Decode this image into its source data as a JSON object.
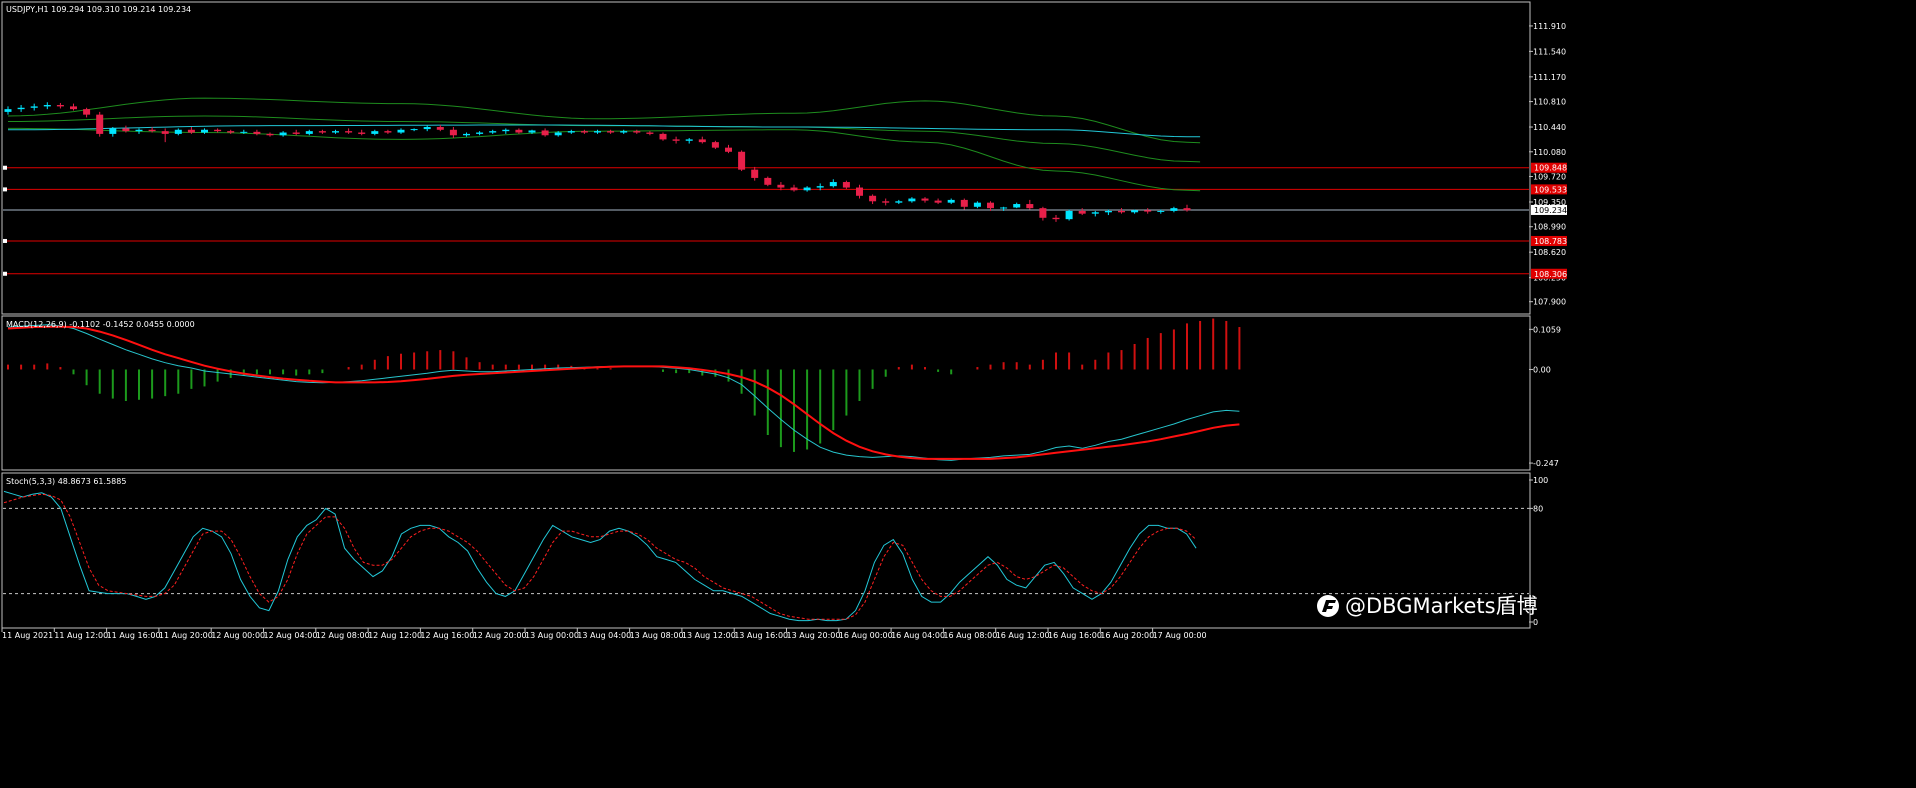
{
  "colors": {
    "background": "#000000",
    "frame": "#c0c0c0",
    "text": "#ffffff",
    "bull_candle": "#00e5ff",
    "bear_candle": "#e8204a",
    "bands": "#1e8c1e",
    "ma_slow": "#22c8d8",
    "red_level": "#e00000",
    "price_line": "#a9b8c8",
    "macd_line": "#27c4cc",
    "signal_line": "#ff1010",
    "hist_up": "#d01010",
    "hist_down": "#1c9a1c",
    "stoch_main": "#22c8d8",
    "stoch_signal": "#ff2020",
    "stoch_levels": "#c8c8c8"
  },
  "header": {
    "symbol_info": "USDJPY,H1  109.294 109.310 109.214 109.234"
  },
  "watermark": {
    "text": "@DBGMarkets盾博",
    "logo_icon": "dbg-logo-icon"
  },
  "chart_data": [
    {
      "type": "candlestick",
      "title": "USDJPY,H1",
      "ohlc_last": [
        109.294,
        109.31,
        109.214,
        109.234
      ],
      "ylim": [
        107.75,
        112.2
      ],
      "y_ticks": [
        "111.910",
        "111.540",
        "111.170",
        "110.810",
        "110.440",
        "110.080",
        "109.720",
        "109.350",
        "108.990",
        "108.620",
        "108.250",
        "107.900"
      ],
      "current_price": 109.234,
      "current_price_label": "109.234",
      "levels": [
        {
          "value": 109.848,
          "label": "109.848"
        },
        {
          "value": 109.533,
          "label": "109.533"
        },
        {
          "value": 108.783,
          "label": "108.783"
        },
        {
          "value": 108.306,
          "label": "108.306"
        }
      ],
      "x_labels": [
        "11 Aug 2021",
        "11 Aug 12:00",
        "11 Aug 16:00",
        "11 Aug 20:00",
        "12 Aug 00:00",
        "12 Aug 04:00",
        "12 Aug 08:00",
        "12 Aug 12:00",
        "12 Aug 16:00",
        "12 Aug 20:00",
        "13 Aug 00:00",
        "13 Aug 04:00",
        "13 Aug 08:00",
        "13 Aug 12:00",
        "13 Aug 16:00",
        "13 Aug 20:00",
        "16 Aug 00:00",
        "16 Aug 04:00",
        "16 Aug 08:00",
        "16 Aug 12:00",
        "16 Aug 16:00",
        "16 Aug 20:00",
        "17 Aug 00:00"
      ],
      "candles": [
        [
          110.66,
          110.74,
          110.62,
          110.7
        ],
        [
          110.7,
          110.76,
          110.66,
          110.72
        ],
        [
          110.72,
          110.78,
          110.68,
          110.74
        ],
        [
          110.74,
          110.8,
          110.7,
          110.76
        ],
        [
          110.76,
          110.79,
          110.71,
          110.74
        ],
        [
          110.74,
          110.78,
          110.68,
          110.7
        ],
        [
          110.7,
          110.72,
          110.58,
          110.62
        ],
        [
          110.62,
          110.66,
          110.3,
          110.34
        ],
        [
          110.34,
          110.44,
          110.3,
          110.42
        ],
        [
          110.42,
          110.46,
          110.36,
          110.38
        ],
        [
          110.38,
          110.42,
          110.34,
          110.4
        ],
        [
          110.4,
          110.44,
          110.36,
          110.38
        ],
        [
          110.38,
          110.42,
          110.22,
          110.34
        ],
        [
          110.34,
          110.42,
          110.32,
          110.4
        ],
        [
          110.4,
          110.44,
          110.34,
          110.36
        ],
        [
          110.36,
          110.42,
          110.34,
          110.4
        ],
        [
          110.4,
          110.42,
          110.36,
          110.38
        ],
        [
          110.38,
          110.4,
          110.34,
          110.36
        ],
        [
          110.36,
          110.4,
          110.34,
          110.37
        ],
        [
          110.37,
          110.4,
          110.32,
          110.34
        ],
        [
          110.34,
          110.36,
          110.3,
          110.32
        ],
        [
          110.32,
          110.38,
          110.3,
          110.36
        ],
        [
          110.36,
          110.4,
          110.32,
          110.34
        ],
        [
          110.34,
          110.4,
          110.32,
          110.38
        ],
        [
          110.38,
          110.4,
          110.34,
          110.36
        ],
        [
          110.36,
          110.4,
          110.34,
          110.38
        ],
        [
          110.38,
          110.42,
          110.34,
          110.36
        ],
        [
          110.36,
          110.4,
          110.32,
          110.34
        ],
        [
          110.34,
          110.4,
          110.32,
          110.38
        ],
        [
          110.38,
          110.4,
          110.34,
          110.36
        ],
        [
          110.36,
          110.42,
          110.34,
          110.4
        ],
        [
          110.4,
          110.42,
          110.38,
          110.41
        ],
        [
          110.41,
          110.46,
          110.38,
          110.44
        ],
        [
          110.44,
          110.47,
          110.38,
          110.4
        ],
        [
          110.4,
          110.44,
          110.28,
          110.32
        ],
        [
          110.32,
          110.36,
          110.3,
          110.34
        ],
        [
          110.34,
          110.38,
          110.32,
          110.36
        ],
        [
          110.36,
          110.4,
          110.34,
          110.38
        ],
        [
          110.38,
          110.42,
          110.34,
          110.4
        ],
        [
          110.4,
          110.42,
          110.34,
          110.36
        ],
        [
          110.36,
          110.4,
          110.34,
          110.39
        ],
        [
          110.39,
          110.42,
          110.3,
          110.32
        ],
        [
          110.32,
          110.38,
          110.3,
          110.36
        ],
        [
          110.36,
          110.4,
          110.34,
          110.38
        ],
        [
          110.38,
          110.4,
          110.34,
          110.36
        ],
        [
          110.36,
          110.4,
          110.34,
          110.38
        ],
        [
          110.38,
          110.4,
          110.34,
          110.36
        ],
        [
          110.36,
          110.4,
          110.34,
          110.38
        ],
        [
          110.38,
          110.4,
          110.34,
          110.36
        ],
        [
          110.36,
          110.38,
          110.32,
          110.34
        ],
        [
          110.34,
          110.36,
          110.24,
          110.26
        ],
        [
          110.26,
          110.3,
          110.2,
          110.24
        ],
        [
          110.24,
          110.28,
          110.2,
          110.26
        ],
        [
          110.26,
          110.3,
          110.2,
          110.22
        ],
        [
          110.22,
          110.24,
          110.12,
          110.14
        ],
        [
          110.14,
          110.18,
          110.06,
          110.08
        ],
        [
          110.08,
          110.1,
          109.8,
          109.82
        ],
        [
          109.82,
          109.86,
          109.66,
          109.7
        ],
        [
          109.7,
          109.72,
          109.58,
          109.6
        ],
        [
          109.6,
          109.64,
          109.52,
          109.56
        ],
        [
          109.56,
          109.6,
          109.5,
          109.52
        ],
        [
          109.52,
          109.58,
          109.5,
          109.56
        ],
        [
          109.56,
          109.62,
          109.52,
          109.58
        ],
        [
          109.58,
          109.68,
          109.56,
          109.64
        ],
        [
          109.64,
          109.66,
          109.54,
          109.56
        ],
        [
          109.56,
          109.6,
          109.4,
          109.44
        ],
        [
          109.44,
          109.46,
          109.32,
          109.36
        ],
        [
          109.36,
          109.4,
          109.3,
          109.34
        ],
        [
          109.34,
          109.38,
          109.32,
          109.36
        ],
        [
          109.36,
          109.42,
          109.34,
          109.4
        ],
        [
          109.4,
          109.42,
          109.34,
          109.37
        ],
        [
          109.37,
          109.4,
          109.32,
          109.34
        ],
        [
          109.34,
          109.4,
          109.32,
          109.38
        ],
        [
          109.38,
          109.4,
          109.24,
          109.28
        ],
        [
          109.28,
          109.36,
          109.26,
          109.34
        ],
        [
          109.34,
          109.36,
          109.22,
          109.26
        ],
        [
          109.26,
          109.28,
          109.22,
          109.27
        ],
        [
          109.27,
          109.34,
          109.26,
          109.32
        ],
        [
          109.32,
          109.38,
          109.24,
          109.26
        ],
        [
          109.26,
          109.28,
          109.08,
          109.12
        ],
        [
          109.12,
          109.16,
          109.06,
          109.1
        ],
        [
          109.1,
          109.24,
          109.08,
          109.22
        ],
        [
          109.22,
          109.26,
          109.16,
          109.18
        ],
        [
          109.18,
          109.22,
          109.14,
          109.2
        ],
        [
          109.2,
          109.24,
          109.16,
          109.22
        ],
        [
          109.22,
          109.26,
          109.18,
          109.2
        ],
        [
          109.2,
          109.24,
          109.18,
          109.23
        ],
        [
          109.23,
          109.26,
          109.18,
          109.21
        ],
        [
          109.21,
          109.24,
          109.18,
          109.22
        ],
        [
          109.22,
          109.28,
          109.2,
          109.26
        ],
        [
          109.26,
          109.31,
          109.21,
          109.23
        ]
      ],
      "bands_upper": [
        [
          0,
          110.6
        ],
        [
          15,
          110.86
        ],
        [
          30,
          110.78
        ],
        [
          45,
          110.56
        ],
        [
          60,
          110.64
        ],
        [
          70,
          110.82
        ],
        [
          80,
          110.6
        ],
        [
          90,
          110.22
        ],
        [
          100,
          109.9
        ],
        [
          110,
          109.66
        ],
        [
          120,
          109.56
        ],
        [
          130,
          109.62
        ],
        [
          140,
          109.42
        ]
      ],
      "bands_mid": [
        [
          0,
          110.52
        ],
        [
          15,
          110.6
        ],
        [
          30,
          110.52
        ],
        [
          45,
          110.46
        ],
        [
          60,
          110.44
        ],
        [
          70,
          110.38
        ],
        [
          80,
          110.2
        ],
        [
          90,
          109.94
        ],
        [
          100,
          109.66
        ],
        [
          110,
          109.5
        ],
        [
          120,
          109.4
        ],
        [
          130,
          109.3
        ],
        [
          140,
          109.28
        ]
      ],
      "bands_lower": [
        [
          0,
          110.42
        ],
        [
          15,
          110.36
        ],
        [
          30,
          110.26
        ],
        [
          45,
          110.38
        ],
        [
          60,
          110.4
        ],
        [
          70,
          110.22
        ],
        [
          80,
          109.8
        ],
        [
          90,
          109.52
        ],
        [
          100,
          109.22
        ],
        [
          110,
          109.12
        ],
        [
          120,
          109.1
        ],
        [
          130,
          109.12
        ],
        [
          140,
          109.14
        ]
      ],
      "ma_slow": [
        [
          0,
          110.4
        ],
        [
          20,
          110.46
        ],
        [
          40,
          110.47
        ],
        [
          60,
          110.44
        ],
        [
          80,
          110.4
        ],
        [
          90,
          110.3
        ],
        [
          100,
          110.2
        ],
        [
          110,
          110.08
        ],
        [
          120,
          109.96
        ],
        [
          130,
          109.84
        ],
        [
          140,
          109.74
        ]
      ]
    },
    {
      "type": "line",
      "title": "MACD(12,26,9) -0.1102 -0.1452 0.0455 0.0000",
      "ylim": [
        -0.26,
        0.12
      ],
      "y_ticks": [
        "0.1059",
        "0.00",
        "-0.247"
      ],
      "macd": [
        0.112,
        0.114,
        0.116,
        0.118,
        0.115,
        0.108,
        0.095,
        0.08,
        0.066,
        0.052,
        0.04,
        0.028,
        0.018,
        0.01,
        0.004,
        -0.004,
        -0.008,
        -0.012,
        -0.016,
        -0.02,
        -0.024,
        -0.028,
        -0.032,
        -0.034,
        -0.035,
        -0.034,
        -0.032,
        -0.03,
        -0.026,
        -0.022,
        -0.018,
        -0.014,
        -0.01,
        -0.005,
        -0.002,
        -0.004,
        -0.006,
        -0.006,
        -0.004,
        -0.002,
        0.0,
        0.002,
        0.004,
        0.005,
        0.006,
        0.007,
        0.008,
        0.008,
        0.008,
        0.008,
        0.006,
        0.003,
        0.0,
        -0.006,
        -0.012,
        -0.022,
        -0.04,
        -0.07,
        -0.102,
        -0.132,
        -0.16,
        -0.184,
        -0.205,
        -0.218,
        -0.226,
        -0.23,
        -0.232,
        -0.23,
        -0.228,
        -0.23,
        -0.234,
        -0.238,
        -0.24,
        -0.236,
        -0.234,
        -0.232,
        -0.228,
        -0.226,
        -0.224,
        -0.216,
        -0.206,
        -0.202,
        -0.208,
        -0.2,
        -0.19,
        -0.184,
        -0.174,
        -0.164,
        -0.154,
        -0.144,
        -0.132,
        -0.122,
        -0.112,
        -0.108,
        -0.11
      ],
      "signal": [
        0.108,
        0.11,
        0.112,
        0.113,
        0.113,
        0.112,
        0.108,
        0.1,
        0.09,
        0.078,
        0.065,
        0.052,
        0.04,
        0.03,
        0.02,
        0.01,
        0.002,
        -0.005,
        -0.011,
        -0.016,
        -0.02,
        -0.024,
        -0.027,
        -0.03,
        -0.032,
        -0.034,
        -0.034,
        -0.034,
        -0.034,
        -0.033,
        -0.031,
        -0.028,
        -0.025,
        -0.021,
        -0.017,
        -0.014,
        -0.012,
        -0.01,
        -0.008,
        -0.006,
        -0.004,
        -0.002,
        0.0,
        0.002,
        0.004,
        0.006,
        0.007,
        0.008,
        0.008,
        0.008,
        0.008,
        0.006,
        0.003,
        -0.001,
        -0.006,
        -0.012,
        -0.02,
        -0.032,
        -0.048,
        -0.068,
        -0.092,
        -0.118,
        -0.144,
        -0.168,
        -0.188,
        -0.204,
        -0.216,
        -0.224,
        -0.23,
        -0.234,
        -0.236,
        -0.236,
        -0.236,
        -0.236,
        -0.236,
        -0.236,
        -0.234,
        -0.232,
        -0.228,
        -0.224,
        -0.22,
        -0.216,
        -0.212,
        -0.208,
        -0.204,
        -0.2,
        -0.195,
        -0.19,
        -0.184,
        -0.177,
        -0.17,
        -0.162,
        -0.154,
        -0.148,
        -0.145
      ]
    },
    {
      "type": "line",
      "title": "Stoch(5,3,3) 48.8673 61.5885",
      "ylim": [
        0,
        100
      ],
      "y_ticks": [
        "100",
        "80",
        "0"
      ],
      "levels": [
        80,
        20
      ],
      "main": [
        92,
        90,
        88,
        90,
        91,
        88,
        80,
        60,
        40,
        22,
        21,
        20,
        20,
        20,
        18,
        16,
        18,
        24,
        36,
        48,
        60,
        66,
        64,
        60,
        48,
        30,
        18,
        10,
        8,
        22,
        44,
        60,
        68,
        72,
        80,
        76,
        52,
        44,
        38,
        32,
        36,
        46,
        62,
        66,
        68,
        68,
        66,
        60,
        56,
        50,
        38,
        28,
        20,
        18,
        22,
        34,
        46,
        58,
        68,
        64,
        60,
        58,
        56,
        58,
        64,
        66,
        64,
        60,
        54,
        46,
        44,
        42,
        36,
        30,
        26,
        22,
        22,
        20,
        18,
        14,
        10,
        6,
        4,
        2,
        1,
        1,
        2,
        1,
        1,
        2,
        8,
        22,
        42,
        54,
        58,
        48,
        30,
        18,
        14,
        14,
        20,
        28,
        34,
        40,
        46,
        40,
        30,
        26,
        24,
        32,
        40,
        42,
        34,
        24,
        20,
        16,
        20,
        28,
        40,
        52,
        62,
        68,
        68,
        66,
        66,
        62,
        52
      ],
      "signal": [
        84,
        86,
        88,
        89,
        90,
        89,
        86,
        74,
        56,
        38,
        26,
        22,
        21,
        20,
        19,
        18,
        18,
        20,
        26,
        38,
        50,
        62,
        64,
        64,
        58,
        46,
        32,
        20,
        14,
        18,
        30,
        48,
        62,
        68,
        74,
        74,
        66,
        52,
        42,
        40,
        40,
        44,
        52,
        60,
        64,
        66,
        66,
        64,
        60,
        56,
        50,
        42,
        34,
        26,
        22,
        24,
        32,
        44,
        56,
        64,
        64,
        62,
        60,
        60,
        62,
        64,
        64,
        62,
        58,
        52,
        48,
        44,
        42,
        38,
        32,
        28,
        24,
        22,
        20,
        18,
        14,
        10,
        6,
        4,
        3,
        2,
        2,
        2,
        2,
        2,
        5,
        14,
        30,
        46,
        56,
        54,
        42,
        30,
        22,
        18,
        18,
        22,
        28,
        34,
        40,
        42,
        38,
        32,
        30,
        32,
        36,
        40,
        38,
        32,
        26,
        22,
        20,
        24,
        32,
        42,
        52,
        60,
        64,
        66,
        66,
        64,
        58
      ]
    }
  ]
}
